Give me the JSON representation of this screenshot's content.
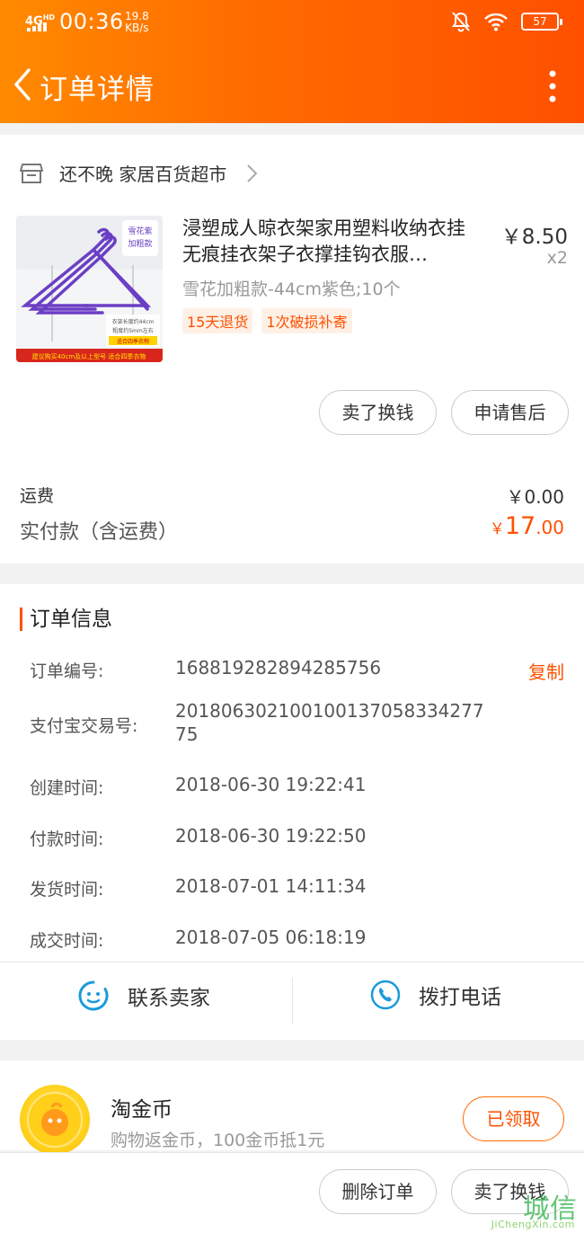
{
  "status_bar": {
    "network": "4G",
    "network_sub": "HD",
    "time": "00:36",
    "speed_value": "19.8",
    "speed_unit": "KB/s",
    "battery": "57",
    "icons": [
      "mute-bell-icon",
      "wifi-icon",
      "battery-icon"
    ]
  },
  "nav": {
    "title": "订单详情",
    "back_icon": "chevron-left-icon",
    "more_icon": "vertical-dots-icon"
  },
  "shop": {
    "name": "还不晚 家居百货超市",
    "icon": "store-icon"
  },
  "product": {
    "title": "浸塑成人晾衣架家用塑料收纳衣挂 无痕挂衣架子衣撑挂钩衣服…",
    "price": "￥8.50",
    "quantity": "x2",
    "sku": "雪花加粗款-44cm紫色;10个",
    "tags": [
      "15天退货",
      "1次破损补寄"
    ],
    "image": {
      "badge_line1": "雪花紫",
      "badge_line2": "加粗款",
      "spec_line1": "衣架长度约44cm",
      "spec_line2": "粗度约5mm左右",
      "spec_line3": "适合四季衣物",
      "footer": "建议购买40cm及以上型号 适合四季衣物"
    }
  },
  "item_actions": {
    "sell": "卖了换钱",
    "after_sale": "申请售后"
  },
  "fees": {
    "shipping_label": "运费",
    "shipping_value": "￥0.00",
    "paid_label": "实付款（含运费）",
    "paid_currency": "￥",
    "paid_integer": "17",
    "paid_decimal": ".00"
  },
  "order_info": {
    "title": "订单信息",
    "copy_label": "复制",
    "rows": [
      {
        "label": "订单编号:",
        "value": "168819282894285756"
      },
      {
        "label": "支付宝交易号:",
        "value": "20180630210010013705833427775"
      },
      {
        "label": "创建时间:",
        "value": "2018-06-30 19:22:41"
      },
      {
        "label": "付款时间:",
        "value": "2018-06-30 19:22:50"
      },
      {
        "label": "发货时间:",
        "value": "2018-07-01 14:11:34"
      },
      {
        "label": "成交时间:",
        "value": "2018-07-05 06:18:19"
      }
    ],
    "contact_seller": "联系卖家",
    "call_phone": "拨打电话"
  },
  "coin": {
    "title": "淘金币",
    "subtitle": "购物返金币，100金币抵1元",
    "button": "已领取"
  },
  "bottom_bar": {
    "delete": "删除订单",
    "sell": "卖了换钱"
  },
  "watermark": {
    "cn": "城信",
    "en": "JiChengXin.com"
  },
  "colors": {
    "accent": "#ff5000",
    "header_start": "#ff8a00",
    "header_end": "#ff5000",
    "icon_blue": "#1a9bdb"
  }
}
